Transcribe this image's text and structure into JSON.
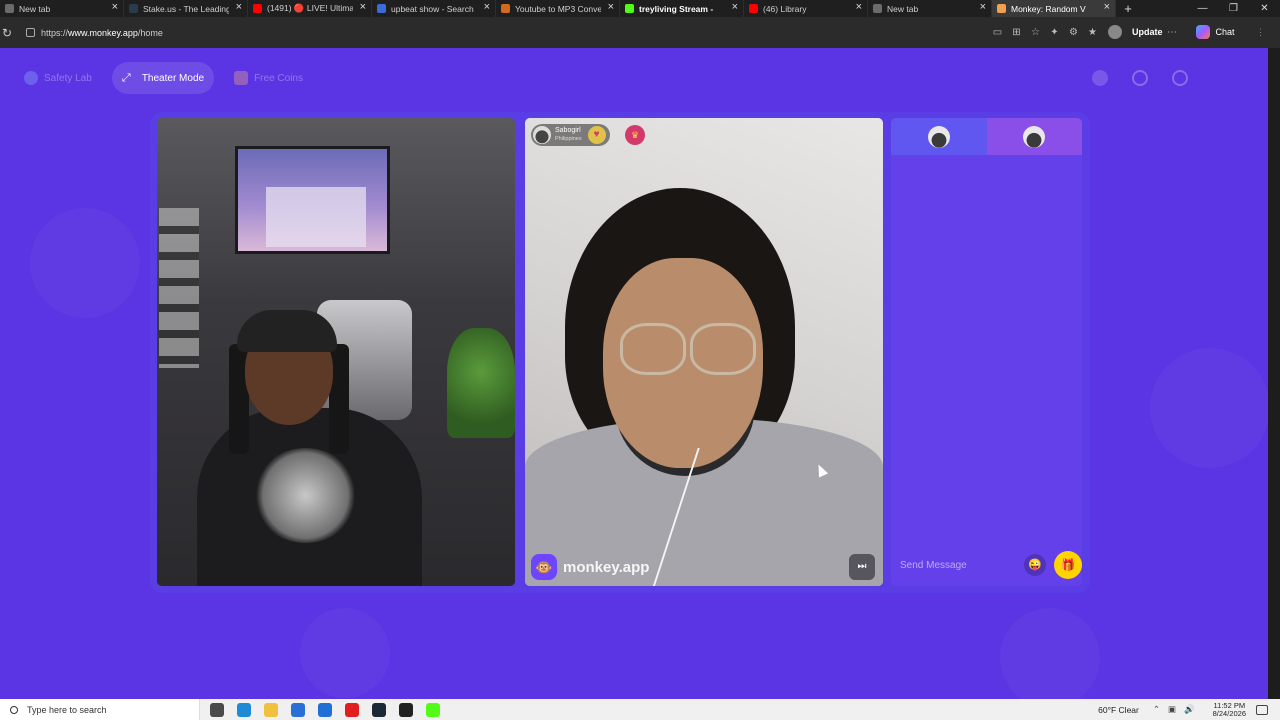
{
  "browser": {
    "tabs": [
      {
        "title": "New tab",
        "fav_color": "#6b6b6b",
        "active": false,
        "bold": false
      },
      {
        "title": "Stake.us - The Leading",
        "fav_color": "#2b3b4b",
        "active": false,
        "bold": false
      },
      {
        "title": "(1491) 🔴 LIVE! Ultimat",
        "fav_color": "#ff0000",
        "active": false,
        "bold": false
      },
      {
        "title": "upbeat show - Search",
        "fav_color": "#3b6bd6",
        "active": false,
        "bold": false
      },
      {
        "title": "Youtube to MP3 Conve",
        "fav_color": "#d2691e",
        "active": false,
        "bold": false
      },
      {
        "title": "treyliving Stream -",
        "fav_color": "#53fc18",
        "active": false,
        "bold": true
      },
      {
        "title": "(46) Library",
        "fav_color": "#ff0000",
        "active": false,
        "bold": false
      },
      {
        "title": "New tab",
        "fav_color": "#6b6b6b",
        "active": false,
        "bold": false
      },
      {
        "title": "Monkey: Random V",
        "fav_color": "#f0a050",
        "active": true,
        "bold": false
      }
    ],
    "url_prefix": "https://",
    "url_host": "www.monkey.app",
    "url_path": "/home",
    "update_label": "Update",
    "chat_label": "Chat"
  },
  "nav": {
    "safety_lab": "Safety Lab",
    "theater_mode": "Theater Mode",
    "free_coins": "Free Coins"
  },
  "remote_user": {
    "name": "Sabogirl",
    "country": "Philippines"
  },
  "watermark": "monkey.app",
  "chat": {
    "placeholder": "Send Message"
  },
  "taskbar": {
    "search_placeholder": "Type here to search",
    "weather": "60°F  Clear",
    "time": "11:52 PM",
    "date": "8/24/2026"
  },
  "colors": {
    "page_bg": "#5b34e3",
    "chat_bg": "#6440ea",
    "gift_button": "#ffd400",
    "accent_tab": "#8a4fe8"
  }
}
